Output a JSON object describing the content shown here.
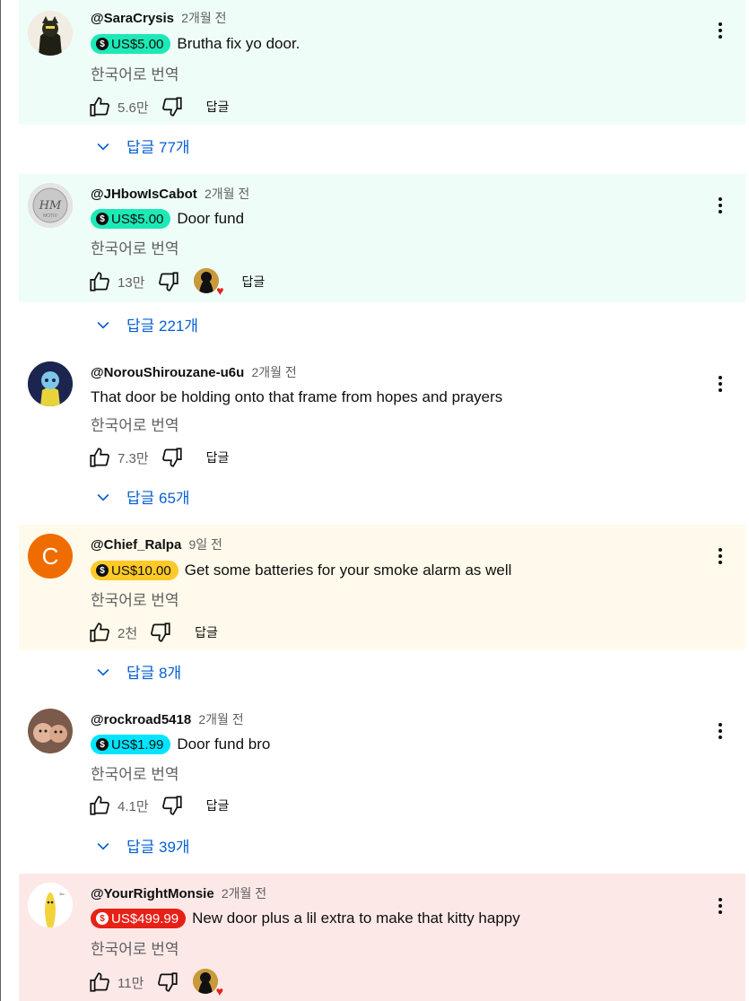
{
  "comments": [
    {
      "author": "@SaraCrysis",
      "time": "2개월 전",
      "chip": "US$5.00",
      "chip_color": "#1de9b6",
      "bg": "#effdf8",
      "text": "Brutha fix yo door.",
      "translate": "한국어로 번역",
      "likes": "5.6만",
      "reply": "답글",
      "replies_label": "답글 77개",
      "has_heart": false
    },
    {
      "author": "@JHbowIsCabot",
      "time": "2개월 전",
      "chip": "US$5.00",
      "chip_color": "#1de9b6",
      "bg": "#effdf8",
      "text": "Door fund",
      "translate": "한국어로 번역",
      "likes": "13만",
      "reply": "답글",
      "replies_label": "답글 221개",
      "has_heart": true
    },
    {
      "author": "@NorouShirouzane-u6u",
      "time": "2개월 전",
      "chip": "",
      "chip_color": "",
      "bg": "#ffffff",
      "text": "That door be holding onto that frame from hopes and prayers",
      "translate": "한국어로 번역",
      "likes": "7.3만",
      "reply": "답글",
      "replies_label": "답글 65개",
      "has_heart": false
    },
    {
      "author": "@Chief_Ralpa",
      "time": "9일 전",
      "chip": "US$10.00",
      "chip_color": "#ffca28",
      "bg": "#fffaeb",
      "text": "Get some batteries for your smoke alarm as well",
      "translate": "한국어로 번역",
      "likes": "2천",
      "reply": "답글",
      "replies_label": "답글 8개",
      "has_heart": false,
      "avatar_letter": "C",
      "avatar_color": "#ef6c00"
    },
    {
      "author": "@rockroad5418",
      "time": "2개월 전",
      "chip": "US$1.99",
      "chip_color": "#00e5ff",
      "bg": "#ffffff",
      "text": "Door fund bro",
      "translate": "한국어로 번역",
      "likes": "4.1만",
      "reply": "답글",
      "replies_label": "답글 39개",
      "has_heart": false
    },
    {
      "author": "@YourRightMonsie",
      "time": "2개월 전",
      "chip": "US$499.99",
      "chip_color": "#e62117",
      "bg": "#fde8e8",
      "text": "New door plus a lil extra to make that kitty happy",
      "translate": "한국어로 번역",
      "likes": "11만",
      "reply": "",
      "replies_label": "",
      "has_heart": true
    }
  ],
  "icons": {
    "like": "thumb-up-icon",
    "dislike": "thumb-down-icon",
    "menu": "more-vert-icon",
    "replies": "chevron-down-icon",
    "coin": "super-thanks-icon",
    "heart": "creator-heart-icon"
  }
}
